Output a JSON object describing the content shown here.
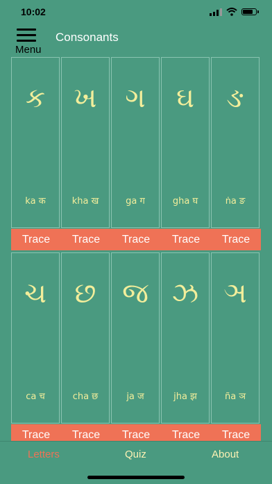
{
  "status_bar": {
    "time": "10:02"
  },
  "header": {
    "menu_label": "Menu",
    "title": "Consonants"
  },
  "letters_row1": [
    {
      "glyph": "ક",
      "translit": "ka क"
    },
    {
      "glyph": "ખ",
      "translit": "kha ख"
    },
    {
      "glyph": "ગ",
      "translit": "ga ग"
    },
    {
      "glyph": "ઘ",
      "translit": "gha घ"
    },
    {
      "glyph": "ઙ",
      "translit": "ṅa ङ"
    }
  ],
  "letters_row2": [
    {
      "glyph": "ચ",
      "translit": "ca च"
    },
    {
      "glyph": "છ",
      "translit": "cha छ"
    },
    {
      "glyph": "જ",
      "translit": "ja ज"
    },
    {
      "glyph": "ઝ",
      "translit": "jha झ"
    },
    {
      "glyph": "ઞ",
      "translit": "ña ञ"
    }
  ],
  "trace_label": "Trace",
  "tabs": [
    {
      "label": "Letters",
      "color": "#ef7256"
    },
    {
      "label": "Quiz",
      "color": "#fdf2b4"
    },
    {
      "label": "About",
      "color": "#fdf2b4"
    }
  ],
  "colors": {
    "background": "#4a9a80",
    "letter": "#f3ee9b",
    "trace_bar": "#ef7256"
  }
}
